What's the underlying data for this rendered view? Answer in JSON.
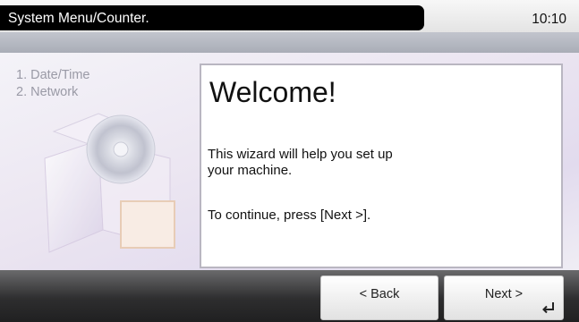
{
  "header": {
    "title": "System Menu/Counter.",
    "clock": "10:10"
  },
  "wizard": {
    "steps": [
      {
        "label": "1. Date/Time"
      },
      {
        "label": "2. Network"
      }
    ],
    "heading": "Welcome!",
    "message_lines": [
      "This wizard will help you set up",
      "your machine."
    ],
    "continue_text": "To continue, press [Next >]."
  },
  "footer": {
    "back_label": "< Back",
    "next_label": "Next >",
    "next_icon": "enter-key-icon"
  },
  "colors": {
    "title_bar": "#000000",
    "bottom_bar": "#2e2e2f",
    "steps_text": "#9a9aa6",
    "panel_border": "#b9b6c1"
  }
}
